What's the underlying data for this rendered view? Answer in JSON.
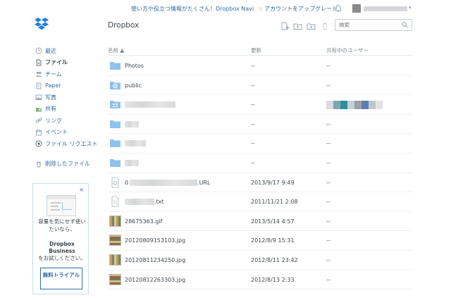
{
  "topbar": {
    "notice": "使い方や役立つ情報がたくさん！Dropbox Navi",
    "upgrade": "アカウントをアップグレード"
  },
  "sidebar": {
    "items": [
      {
        "label": "最近",
        "icon": "clock-icon"
      },
      {
        "label": "ファイル",
        "icon": "file-icon",
        "active": true
      },
      {
        "label": "チーム",
        "icon": "team-icon"
      },
      {
        "label": "Paper",
        "icon": "paper-icon"
      },
      {
        "label": "写真",
        "icon": "photo-icon"
      },
      {
        "label": "共有",
        "icon": "share-icon"
      },
      {
        "label": "リンク",
        "icon": "link-icon"
      },
      {
        "label": "イベント",
        "icon": "calendar-icon"
      },
      {
        "label": "ファイル リクエスト",
        "icon": "file-request-icon"
      }
    ],
    "deleted": "削除したファイル"
  },
  "promo": {
    "close": "×",
    "message": "容量を気にせず使いたいなら、",
    "business_name": "Dropbox Business",
    "business_text": "をお試しください。",
    "trial": "無料トライアル"
  },
  "main": {
    "title": "Dropbox",
    "search_placeholder": "検索",
    "columns": {
      "name": "名前 ▲",
      "modified": "更新",
      "shared": "共有中のユーザー"
    },
    "rows": [
      {
        "name": "Photos",
        "modified": "--",
        "shared": "--",
        "type": "folder"
      },
      {
        "name": "public",
        "modified": "--",
        "shared": "--",
        "type": "public-folder"
      },
      {
        "name": "",
        "modified": "--",
        "shared": "",
        "type": "shared-folder"
      },
      {
        "name": "",
        "modified": "--",
        "shared": "--",
        "type": "folder"
      },
      {
        "name": "",
        "modified": "--",
        "shared": "--",
        "type": "folder"
      },
      {
        "name": "",
        "modified": "--",
        "shared": "--",
        "type": "folder"
      },
      {
        "name_prefix": "0",
        "name": ".URL",
        "modified": "2013/9/17 9:49",
        "shared": "--",
        "type": "url"
      },
      {
        "name": ".txt",
        "modified": "2011/11/21 2:08",
        "shared": "--",
        "type": "txt"
      },
      {
        "name": "28675363.gif",
        "modified": "2013/5/14 4:57",
        "shared": "--",
        "type": "image"
      },
      {
        "name": "20120809153103.jpg",
        "modified": "2012/8/9 15:31",
        "shared": "--",
        "type": "image"
      },
      {
        "name": "20120811234250.jpg",
        "modified": "2012/8/11 23:42",
        "shared": "--",
        "type": "image"
      },
      {
        "name": "20120812263303.jpg",
        "modified": "2012/8/13 2:33",
        "shared": "--",
        "type": "image"
      }
    ]
  },
  "colors": {
    "accent": "#2d6da3",
    "folder": "#8fc2ec",
    "text": "#3d464d",
    "star": "#e0a41c"
  }
}
